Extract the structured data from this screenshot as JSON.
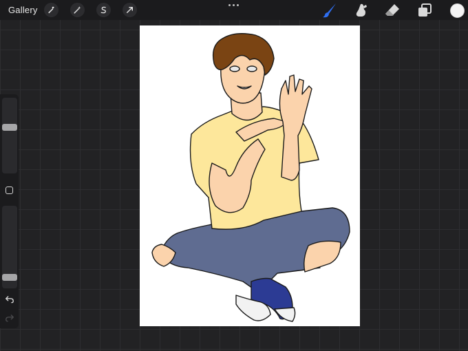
{
  "topbar": {
    "gallery_label": "Gallery",
    "left_tools": [
      "wrench-icon",
      "magic-wand-icon",
      "selection-icon",
      "transform-arrow-icon"
    ],
    "right_tools": [
      "brush-icon",
      "smudge-icon",
      "eraser-icon",
      "layers-icon"
    ],
    "active_tool": "brush",
    "accent_color": "#2f6ff2",
    "current_color": "#f4f4f4"
  },
  "sidebar": {
    "brush_size_level": 0.62,
    "opacity_level": 0.1,
    "controls": [
      "modify-icon",
      "undo-icon",
      "redo-icon"
    ]
  },
  "artwork": {
    "palette": {
      "skin": "#fbd3ac",
      "shirt": "#fde79b",
      "jeans": "#5f6c91",
      "shoes": "#2c3b94",
      "hair": "#7a4413",
      "line": "#1a1a1a"
    }
  }
}
